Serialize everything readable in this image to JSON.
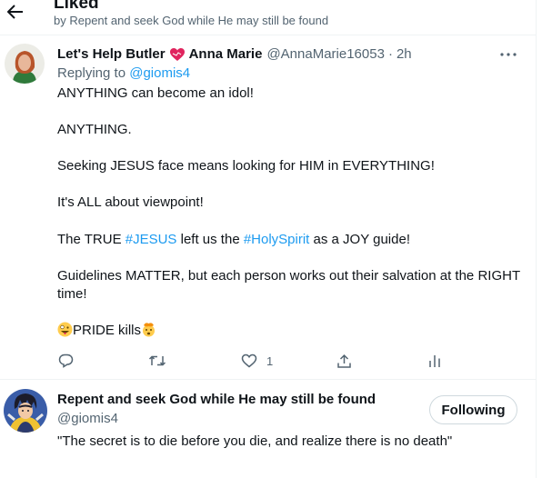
{
  "header": {
    "title": "Liked",
    "subtitle": "by Repent and seek God while He may still be found"
  },
  "tweet": {
    "display_name_part1": "Let's Help Butler",
    "display_name_part2": "Anna Marie",
    "handle": "@AnnaMarie16053",
    "separator": "·",
    "time": "2h",
    "replying_prefix": "Replying to",
    "replying_to": "@giomis4",
    "line1": "ANYTHING can become an idol!",
    "line2": "ANYTHING.",
    "line3": "Seeking JESUS face means looking for HIM in EVERYTHING!",
    "line4": "It's ALL about viewpoint!",
    "line5_a": "The TRUE ",
    "line5_tag1": "#JESUS",
    "line5_b": " left us the ",
    "line5_tag2": "#HolySpirit",
    "line5_c": " as a JOY guide!",
    "line6a": "Guidelines MATTER, but each person works out their salvation at the RIGHT",
    "line6b": "time!",
    "line7": "PRIDE kills",
    "like_count": "1"
  },
  "suggestion": {
    "name": "Repent and seek God while He may still be found",
    "handle": "@giomis4",
    "bio": "\"The secret is to die before you die, and realize there is no death\"",
    "follow_label": "Following"
  },
  "colors": {
    "accent": "#1d9bf0",
    "secondary_text": "#536471",
    "divider": "#eff3f4",
    "heart": "#e0245e"
  }
}
